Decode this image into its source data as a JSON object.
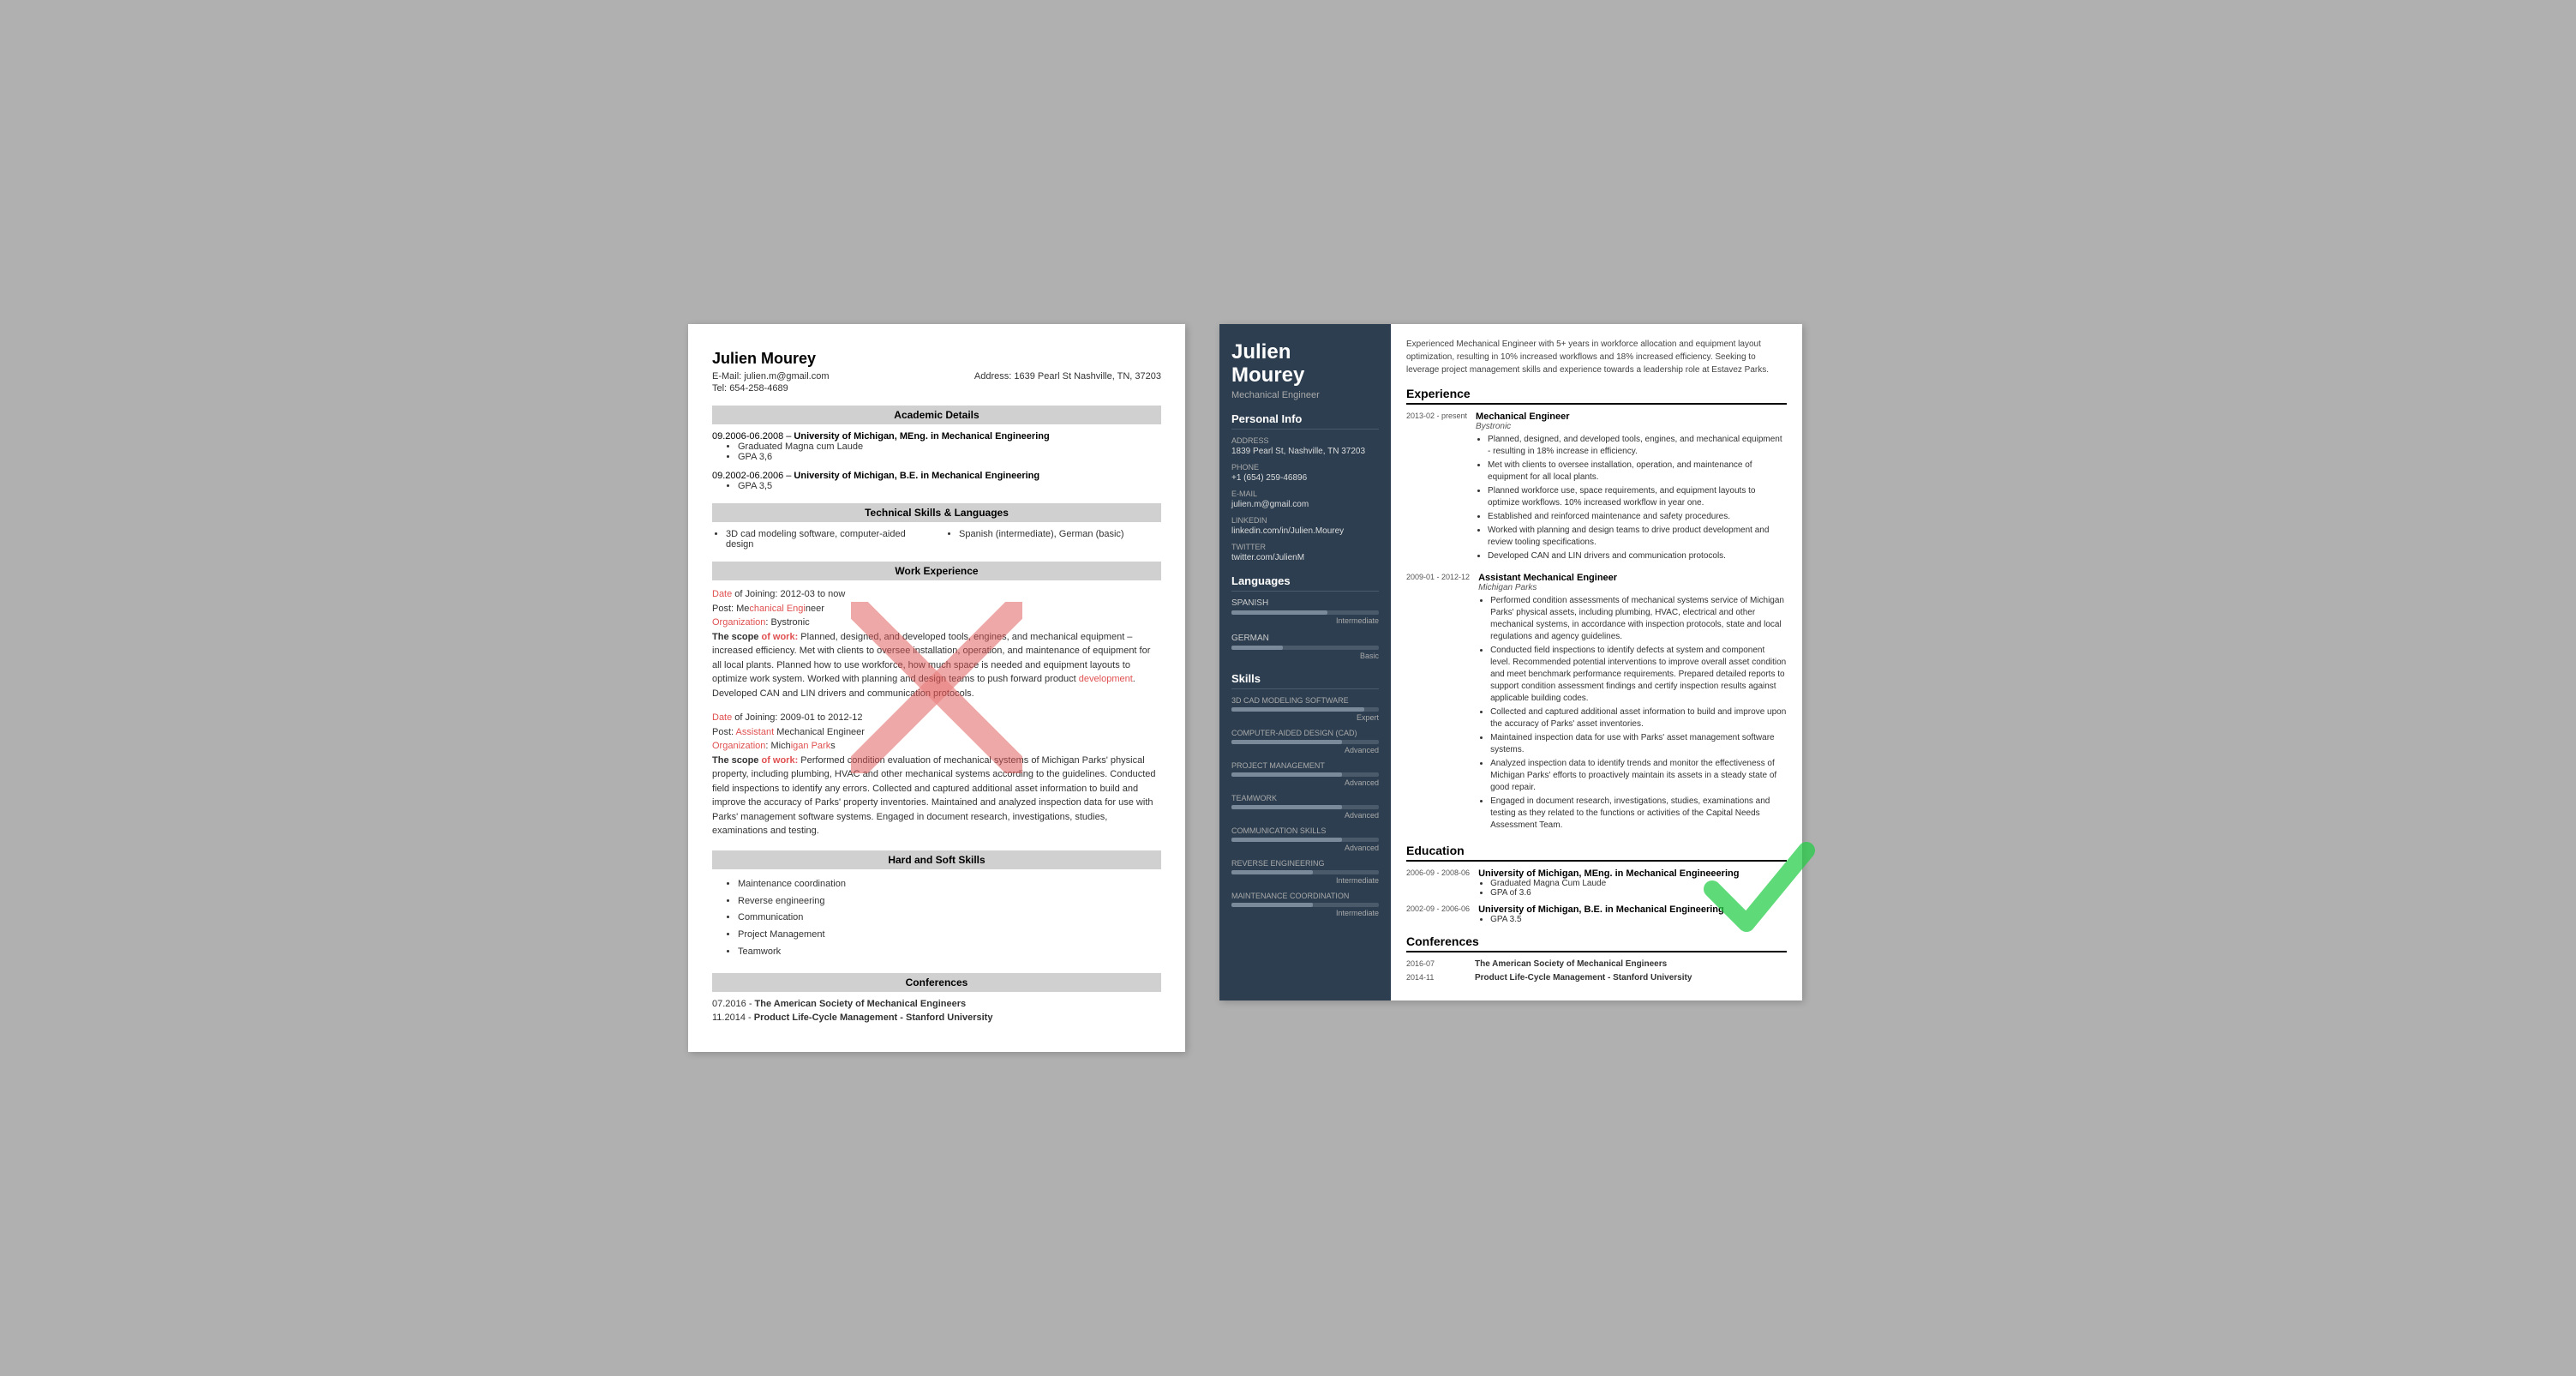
{
  "left_resume": {
    "name": "Julien Mourey",
    "email_label": "E-Mail:",
    "email": "julien.m@gmail.com",
    "tel_label": "Tel:",
    "tel": "654-258-4689",
    "address_label": "Address:",
    "address": "1639 Pearl St Nashville, TN, 37203",
    "sections": {
      "academic": "Academic Details",
      "technical": "Technical Skills & Languages",
      "work": "Work Experience",
      "hard_soft": "Hard and Soft Skills",
      "conferences": "Conferences"
    },
    "education": [
      {
        "date": "09.2006-06.2008",
        "degree": "University of Michigan, MEng. in Mechanical Engineering",
        "details": [
          "Graduated Magna cum Laude",
          "GPA 3,6"
        ]
      },
      {
        "date": "09.2002-06.2006",
        "degree": "University of Michigan, B.E. in Mechanical Engineering",
        "details": [
          "GPA 3,5"
        ]
      }
    ],
    "skills_left": [
      "3D cad modeling software, computer-aided design"
    ],
    "skills_right": [
      "Spanish (intermediate), German (basic)"
    ],
    "work_experience": [
      {
        "date_label": "Date of Joining:",
        "date": "2012-03 to now",
        "post_label": "Post:",
        "post": "Mechanical Engineer",
        "org_label": "Organization:",
        "org": "Bystronic",
        "scope_label": "The scope of work:",
        "scope": "Planned, designed, and developed tools, engines, and mechanical equipment – increased efficiency. Met with clients to oversee installation, operation, and maintenance of equipment for all local plants. Planned how to use workforce, how much space is needed and equipment layouts to optimize work system. Worked with planning and design teams to push forward product development. Developed CAN and LIN drivers and communication protocols."
      },
      {
        "date_label": "Date of Joining:",
        "date": "2009-01 to 2012-12",
        "post_label": "Post:",
        "post": "Assistant Mechanical Engineer",
        "org_label": "Organization:",
        "org": "Michigan Parks",
        "scope_label": "The scope of work:",
        "scope": "Performed condition evaluation of mechanical systems of Michigan Parks' physical property, including plumbing, HVAC and other mechanical systems according to the guidelines. Conducted field inspections to identify any errors. Collected and captured additional asset information to build and improve the accuracy of Parks' property inventories. Maintained and analyzed inspection data for use with Parks' management software systems. Engaged in document research, investigations, studies, examinations and testing."
      }
    ],
    "hard_skills": [
      "Maintenance coordination",
      "Reverse engineering",
      "Communication",
      "Project Management",
      "Teamwork"
    ],
    "conferences": [
      {
        "date": "07.2016",
        "name": "The American Society of Mechanical Engineers"
      },
      {
        "date": "11.2014",
        "name": "Product Life-Cycle Management - Stanford University"
      }
    ]
  },
  "right_resume": {
    "first_name": "Julien",
    "last_name": "Mourey",
    "title": "Mechanical Engineer",
    "personal_info_label": "Personal Info",
    "address_label": "Address",
    "address": "1839 Pearl St, Nashville, TN 37203",
    "phone_label": "Phone",
    "phone": "+1 (654) 259-46896",
    "email_label": "E-mail",
    "email": "julien.m@gmail.com",
    "linkedin_label": "LinkedIn",
    "linkedin": "linkedin.com/in/Julien.Mourey",
    "twitter_label": "Twitter",
    "twitter": "twitter.com/JulienM",
    "languages_label": "Languages",
    "languages": [
      {
        "name": "SPANISH",
        "level": "Intermediate",
        "percent": 65
      },
      {
        "name": "GERMAN",
        "level": "Basic",
        "percent": 35
      }
    ],
    "skills_label": "Skills",
    "skills": [
      {
        "name": "3D CAD MODELING SOFTWARE",
        "level": "Expert",
        "percent": 90
      },
      {
        "name": "COMPUTER-AIDED DESIGN (CAD)",
        "level": "Advanced",
        "percent": 75
      },
      {
        "name": "PROJECT MANAGEMENT",
        "level": "Advanced",
        "percent": 75
      },
      {
        "name": "TEAMWORK",
        "level": "Advanced",
        "percent": 75
      },
      {
        "name": "COMMUNICATION SKILLS",
        "level": "Advanced",
        "percent": 75
      },
      {
        "name": "REVERSE ENGINEERING",
        "level": "Intermediate",
        "percent": 55
      },
      {
        "name": "MAINTENANCE COORDINATION",
        "level": "Intermediate",
        "percent": 55
      }
    ],
    "summary": "Experienced Mechanical Engineer with 5+ years in workforce allocation and equipment layout optimization, resulting in 10% increased workflows and 18% increased efficiency. Seeking to leverage project management skills and experience towards a leadership role at Estavez Parks.",
    "experience_label": "Experience",
    "experience": [
      {
        "date": "2013-02 - present",
        "title": "Mechanical Engineer",
        "company": "Bystronic",
        "bullets": [
          "Planned, designed, and developed tools, engines, and mechanical equipment - resulting in 18% increase in efficiency.",
          "Met with clients to oversee installation, operation, and maintenance of equipment for all local plants.",
          "Planned workforce use, space requirements, and equipment layouts to optimize workflows. 10% increased workflow in year one.",
          "Established and reinforced maintenance and safety procedures.",
          "Worked with planning and design teams to drive product development and review tooling specifications.",
          "Developed CAN and LIN drivers and communication protocols."
        ]
      },
      {
        "date": "2009-01 - 2012-12",
        "title": "Assistant Mechanical Engineer",
        "company": "Michigan Parks",
        "bullets": [
          "Performed condition assessments of mechanical systems service of Michigan Parks' physical assets, including plumbing, HVAC, electrical and other mechanical systems, in accordance with inspection protocols, state and local regulations and agency guidelines.",
          "Conducted field inspections to identify defects at system and component level. Recommended potential interventions to improve overall asset condition and meet benchmark performance requirements. Prepared detailed reports to support condition assessment findings and certify inspection results against applicable building codes.",
          "Collected and captured additional asset information to build and improve upon the accuracy of Parks' asset inventories.",
          "Maintained inspection data for use with Parks' asset management software systems.",
          "Analyzed inspection data to identify trends and monitor the effectiveness of Michigan Parks' efforts to proactively maintain its assets in a steady state of good repair.",
          "Engaged in document research, investigations, studies, examinations and testing as they related to the functions or activities of the Capital Needs Assessment Team."
        ]
      }
    ],
    "education_label": "Education",
    "education": [
      {
        "date": "2006-09 - 2008-06",
        "degree": "University of Michigan, MEng. in Mechanical Engineeering",
        "bullets": [
          "Graduated Magna Cum Laude",
          "GPA of 3.6"
        ]
      },
      {
        "date": "2002-09 - 2006-06",
        "degree": "University of Michigan, B.E. in Mechanical Engineering",
        "bullets": [
          "GPA 3.5"
        ]
      }
    ],
    "conferences_label": "Conferences",
    "conferences": [
      {
        "date": "2016-07",
        "name": "The American Society of Mechanical Engineers"
      },
      {
        "date": "2014-11",
        "name": "Product Life-Cycle Management - Stanford University"
      }
    ]
  }
}
